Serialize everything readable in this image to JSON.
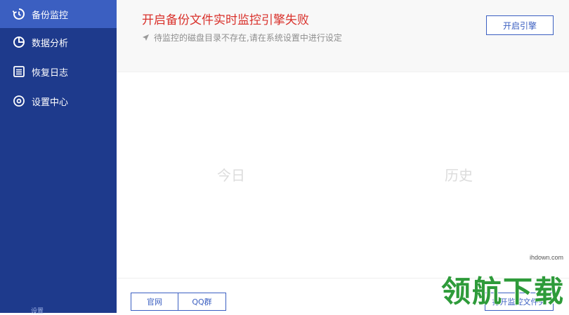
{
  "sidebar": {
    "items": [
      {
        "label": "备份监控",
        "icon": "history-icon",
        "active": true
      },
      {
        "label": "数据分析",
        "icon": "pie-chart-icon",
        "active": false
      },
      {
        "label": "恢复日志",
        "icon": "log-list-icon",
        "active": false
      },
      {
        "label": "设置中心",
        "icon": "settings-target-icon",
        "active": false
      }
    ],
    "footer_text": "设置"
  },
  "header": {
    "alert_title": "开启备份文件实时监控引擎失败",
    "alert_message": "待监控的磁盘目录不存在,请在系统设置中进行设定",
    "start_engine_label": "开启引擎"
  },
  "tabs": {
    "today": "今日",
    "history": "历史"
  },
  "footer": {
    "official_site_label": "官网",
    "qq_group_label": "QQ群",
    "open_monitor_label": "打开监控文件夹"
  },
  "watermark": {
    "domain": "ihdown.com",
    "logo_text": "领航下载"
  },
  "colors": {
    "sidebar_bg": "#1e3a8c",
    "sidebar_active": "#3b5fc1",
    "alert_red": "#d9312b",
    "accent_blue": "#3b5fc1"
  }
}
